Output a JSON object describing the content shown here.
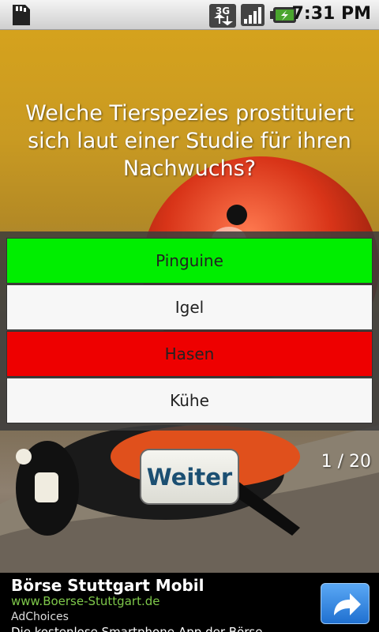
{
  "status_bar": {
    "time": "7:31 PM",
    "network_label": "3G",
    "icons": [
      "sd-card-icon",
      "3g-data-icon",
      "signal-icon",
      "battery-charging-icon"
    ]
  },
  "quiz": {
    "question": "Welche Tierspezies prostituiert sich laut einer Studie für ihren Nachwuchs?",
    "answers": [
      {
        "label": "Pinguine",
        "state": "correct",
        "color": "#00ee00"
      },
      {
        "label": "Igel",
        "state": "neutral",
        "color": "#f7f7f7"
      },
      {
        "label": "Hasen",
        "state": "wrong",
        "color": "#ee0000"
      },
      {
        "label": "Kühe",
        "state": "neutral",
        "color": "#f7f7f7"
      }
    ],
    "next_label": "Weiter",
    "counter": "1 / 20"
  },
  "ad": {
    "title": "Börse Stuttgart Mobil",
    "url": "www.Boerse-Stuttgart.de",
    "choices": "AdChoices",
    "description": "Die kostenlose Smartphone-App der Börse",
    "button_icon": "share-arrow-icon"
  }
}
